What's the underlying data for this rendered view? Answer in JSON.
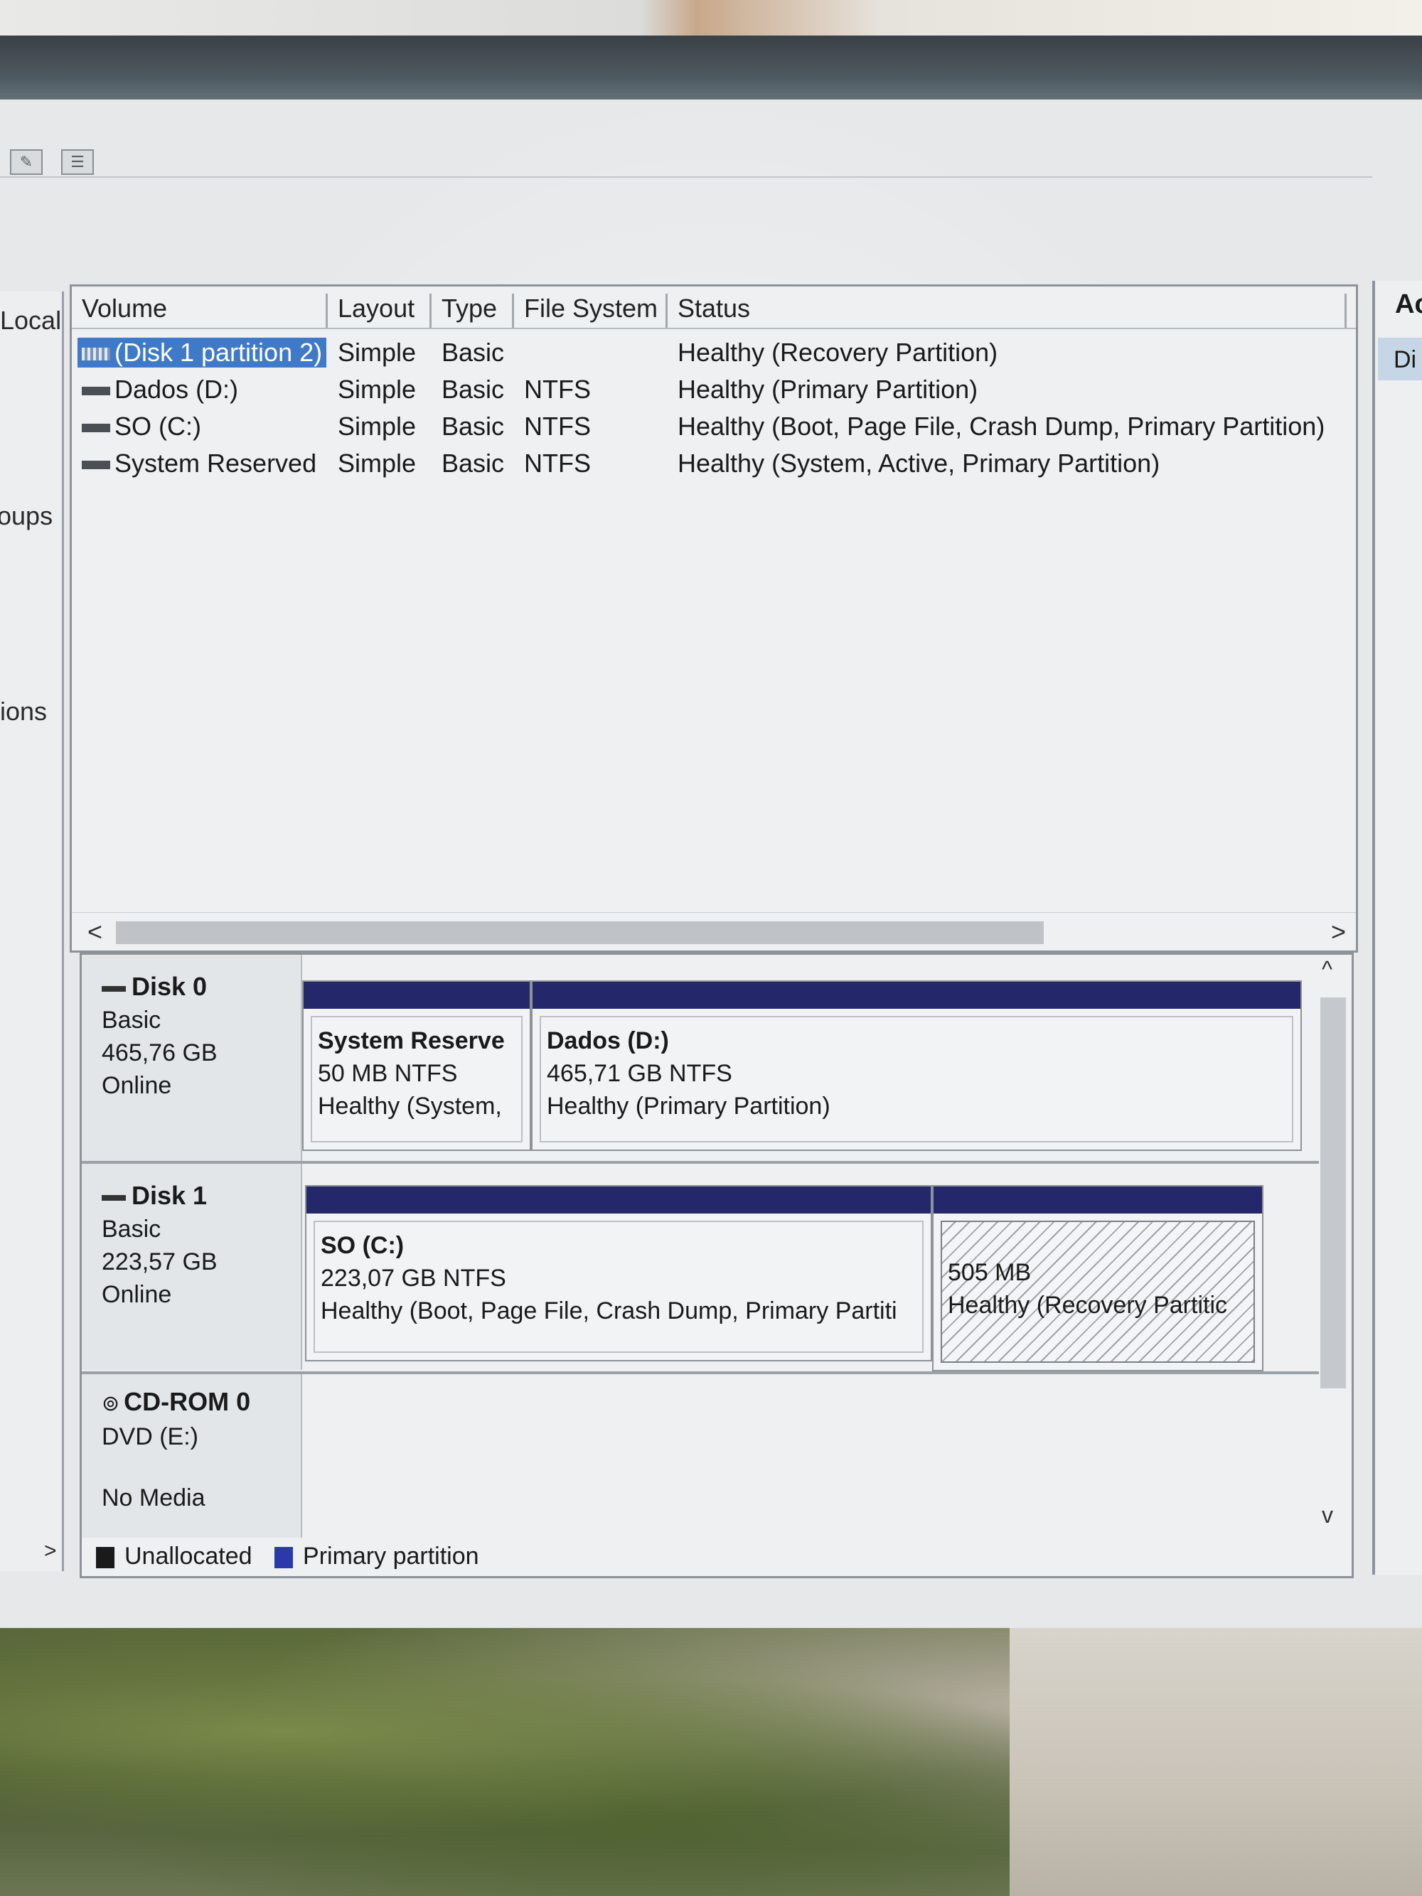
{
  "nav": {
    "items": [
      "Local",
      "oups",
      "ions"
    ]
  },
  "volume_list": {
    "columns": [
      "Volume",
      "Layout",
      "Type",
      "File System",
      "Status"
    ],
    "rows": [
      {
        "volume": "(Disk 1 partition 2)",
        "layout": "Simple",
        "type": "Basic",
        "fs": "",
        "status": "Healthy (Recovery Partition)",
        "selected": true
      },
      {
        "volume": "Dados (D:)",
        "layout": "Simple",
        "type": "Basic",
        "fs": "NTFS",
        "status": "Healthy (Primary Partition)"
      },
      {
        "volume": "SO (C:)",
        "layout": "Simple",
        "type": "Basic",
        "fs": "NTFS",
        "status": "Healthy (Boot, Page File, Crash Dump, Primary Partition)"
      },
      {
        "volume": "System Reserved",
        "layout": "Simple",
        "type": "Basic",
        "fs": "NTFS",
        "status": "Healthy (System, Active, Primary Partition)"
      }
    ],
    "scroll_left": "<",
    "scroll_right": ">"
  },
  "disks": [
    {
      "name": "Disk 0",
      "kind": "Basic",
      "size": "465,76 GB",
      "state": "Online",
      "partitions": [
        {
          "name": "System Reserve",
          "size": "50 MB NTFS",
          "status": "Healthy (System,"
        },
        {
          "name": "Dados  (D:)",
          "size": "465,71 GB NTFS",
          "status": "Healthy (Primary Partition)"
        }
      ]
    },
    {
      "name": "Disk 1",
      "kind": "Basic",
      "size": "223,57 GB",
      "state": "Online",
      "partitions": [
        {
          "name": "SO  (C:)",
          "size": "223,07 GB NTFS",
          "status": "Healthy (Boot, Page File, Crash Dump, Primary Partiti"
        },
        {
          "name": "",
          "size": "505 MB",
          "status": "Healthy (Recovery Partitic"
        }
      ]
    },
    {
      "name": "CD-ROM 0",
      "kind": "DVD (E:)",
      "media": "No Media"
    }
  ],
  "legend": {
    "unallocated": "Unallocated",
    "primary": "Primary partition"
  },
  "actions": {
    "title": "Ac",
    "item": "Di"
  },
  "nav_expand": ">",
  "scroll_up": "^",
  "scroll_down": "v",
  "colors": {
    "partition_bar": "#24286b",
    "selection": "#3f7ac9",
    "unallocated": "#1a1a1a",
    "primary": "#2a3aa8"
  }
}
